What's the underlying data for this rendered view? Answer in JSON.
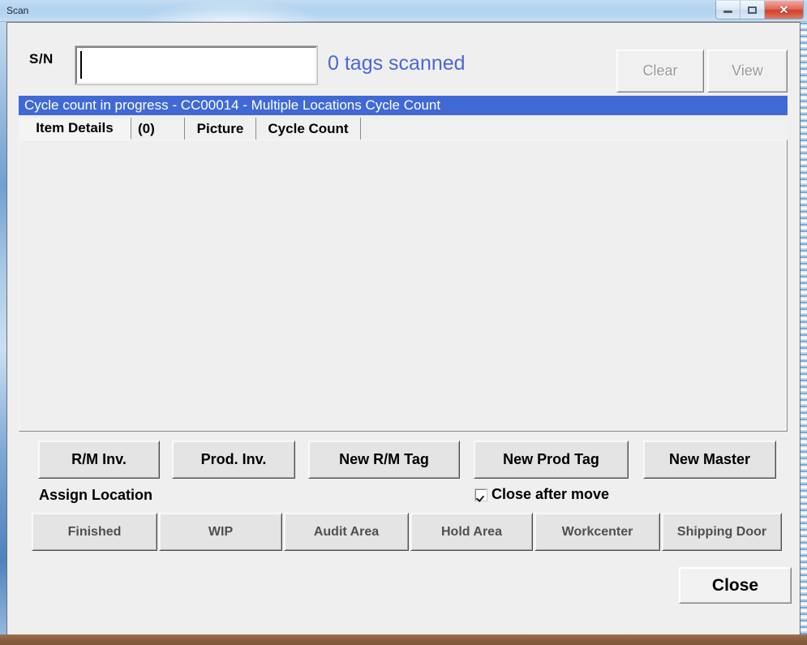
{
  "window": {
    "title": "Scan",
    "controls": {
      "minimize": "minimize-icon",
      "maximize": "maximize-icon",
      "close": "✕"
    }
  },
  "colors": {
    "status_bar_bg": "#4069d6",
    "tags_text": "#4a68d8",
    "titlebar": "#b2d3ef",
    "client_bg": "#efefef",
    "close_button": "#cf3f27"
  },
  "header": {
    "sn_label": "S/N",
    "sn_value": "",
    "sn_placeholder": "",
    "tags_scanned": "0 tags scanned",
    "clear_label": "Clear",
    "view_label": "View",
    "clear_enabled": false,
    "view_enabled": false
  },
  "status": {
    "message": "Cycle count in progress - CC00014 - Multiple Locations Cycle Count"
  },
  "tabs": [
    {
      "label": "Item Details",
      "selected": true
    },
    {
      "label": "(0)",
      "selected": false
    },
    {
      "label": "Picture",
      "selected": false
    },
    {
      "label": "Cycle Count",
      "selected": false
    }
  ],
  "content": {
    "rows": []
  },
  "actions": {
    "primary_row": [
      {
        "label": "R/M Inv."
      },
      {
        "label": "Prod. Inv."
      },
      {
        "label": "New R/M Tag"
      },
      {
        "label": "New Prod Tag"
      },
      {
        "label": "New Master"
      }
    ],
    "assign_location_label": "Assign Location",
    "close_after_move": {
      "label": "Close after move",
      "checked": true
    },
    "location_row": [
      {
        "label": "Finished"
      },
      {
        "label": "WIP"
      },
      {
        "label": "Audit Area"
      },
      {
        "label": "Hold Area"
      },
      {
        "label": "Workcenter"
      },
      {
        "label": "Shipping Door"
      }
    ]
  },
  "footer": {
    "close_label": "Close"
  }
}
